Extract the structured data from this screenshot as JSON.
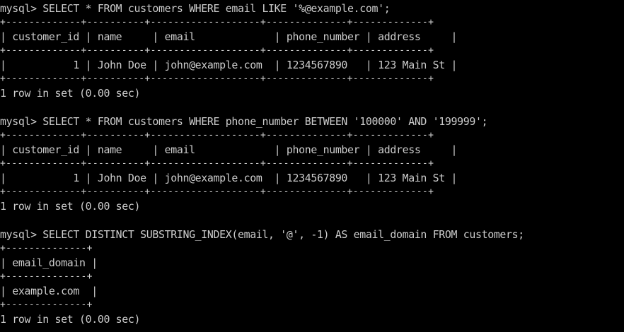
{
  "terminal": {
    "lines": [
      {
        "kind": "prompt",
        "text": "mysql> SELECT * FROM customers WHERE email LIKE '%@example.com';"
      },
      {
        "kind": "border",
        "text": "+-------------+----------+-------------------+--------------+-------------+"
      },
      {
        "kind": "row",
        "text": "| customer_id | name     | email             | phone_number | address     |"
      },
      {
        "kind": "border",
        "text": "+-------------+----------+-------------------+--------------+-------------+"
      },
      {
        "kind": "row",
        "text": "|           1 | John Doe | john@example.com  | 1234567890   | 123 Main St |"
      },
      {
        "kind": "border",
        "text": "+-------------+----------+-------------------+--------------+-------------+"
      },
      {
        "kind": "status",
        "text": "1 row in set (0.00 sec)"
      },
      {
        "kind": "blank",
        "text": ""
      },
      {
        "kind": "prompt",
        "text": "mysql> SELECT * FROM customers WHERE phone_number BETWEEN '100000' AND '199999';"
      },
      {
        "kind": "border",
        "text": "+-------------+----------+-------------------+--------------+-------------+"
      },
      {
        "kind": "row",
        "text": "| customer_id | name     | email             | phone_number | address     |"
      },
      {
        "kind": "border",
        "text": "+-------------+----------+-------------------+--------------+-------------+"
      },
      {
        "kind": "row",
        "text": "|           1 | John Doe | john@example.com  | 1234567890   | 123 Main St |"
      },
      {
        "kind": "border",
        "text": "+-------------+----------+-------------------+--------------+-------------+"
      },
      {
        "kind": "status",
        "text": "1 row in set (0.00 sec)"
      },
      {
        "kind": "blank",
        "text": ""
      },
      {
        "kind": "prompt",
        "text": "mysql> SELECT DISTINCT SUBSTRING_INDEX(email, '@', -1) AS email_domain FROM customers;"
      },
      {
        "kind": "border",
        "text": "+--------------+"
      },
      {
        "kind": "row",
        "text": "| email_domain |"
      },
      {
        "kind": "border",
        "text": "+--------------+"
      },
      {
        "kind": "row",
        "text": "| example.com  |"
      },
      {
        "kind": "border",
        "text": "+--------------+"
      },
      {
        "kind": "status",
        "text": "1 row in set (0.00 sec)"
      }
    ]
  },
  "colors": {
    "background": "#000000",
    "foreground": "#cccccc"
  }
}
